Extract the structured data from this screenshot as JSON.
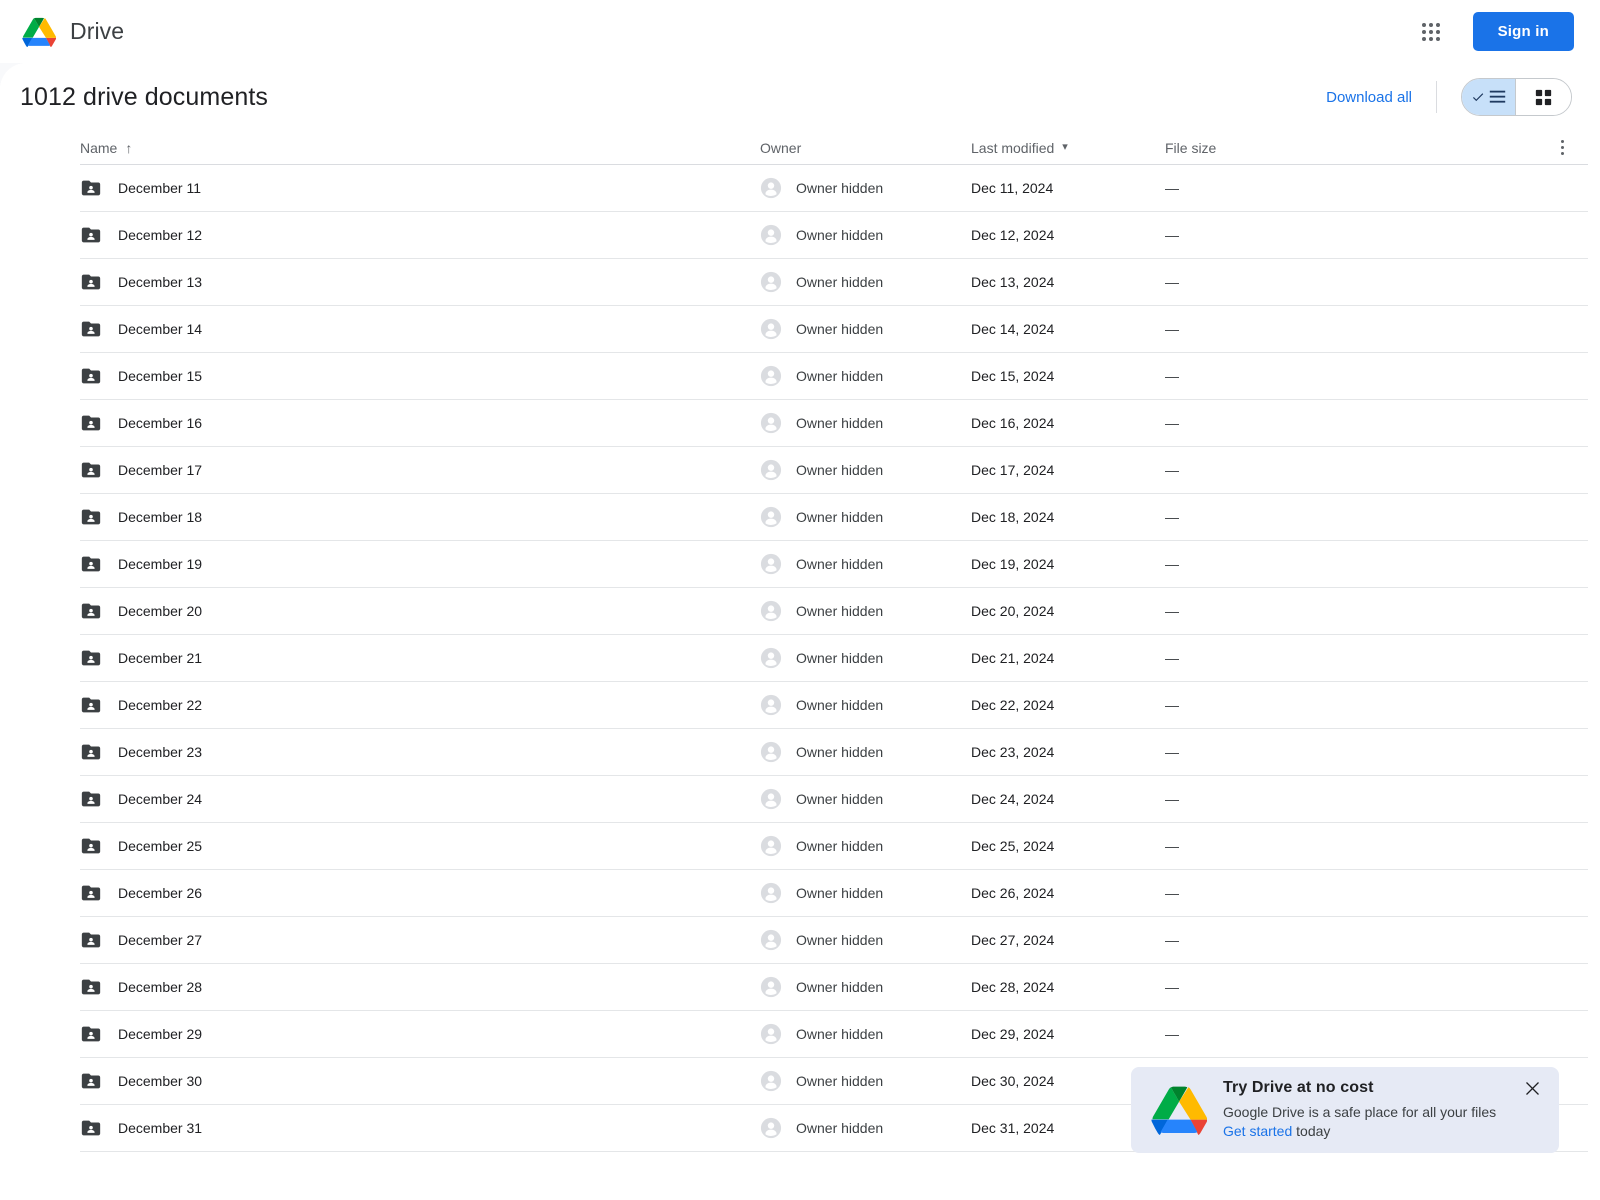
{
  "topbar": {
    "brand_name": "Drive",
    "apps_icon": "apps-grid-icon",
    "signin_label": "Sign in"
  },
  "subheader": {
    "title": "1012 drive documents",
    "download_all_label": "Download all",
    "list_view_icon": "list-view-icon",
    "grid_view_icon": "grid-view-icon",
    "active_view": "list"
  },
  "table": {
    "columns": {
      "name": "Name",
      "owner": "Owner",
      "last_modified": "Last modified",
      "file_size": "File size"
    },
    "sort_column": "Name",
    "sort_arrow": "↑",
    "modified_caret": "▾",
    "more_icon": "more-vertical-icon",
    "rows": [
      {
        "name": "December 11",
        "owner": "Owner hidden",
        "modified": "Dec 11, 2024",
        "size": "—"
      },
      {
        "name": "December 12",
        "owner": "Owner hidden",
        "modified": "Dec 12, 2024",
        "size": "—"
      },
      {
        "name": "December 13",
        "owner": "Owner hidden",
        "modified": "Dec 13, 2024",
        "size": "—"
      },
      {
        "name": "December 14",
        "owner": "Owner hidden",
        "modified": "Dec 14, 2024",
        "size": "—"
      },
      {
        "name": "December 15",
        "owner": "Owner hidden",
        "modified": "Dec 15, 2024",
        "size": "—"
      },
      {
        "name": "December 16",
        "owner": "Owner hidden",
        "modified": "Dec 16, 2024",
        "size": "—"
      },
      {
        "name": "December 17",
        "owner": "Owner hidden",
        "modified": "Dec 17, 2024",
        "size": "—"
      },
      {
        "name": "December 18",
        "owner": "Owner hidden",
        "modified": "Dec 18, 2024",
        "size": "—"
      },
      {
        "name": "December 19",
        "owner": "Owner hidden",
        "modified": "Dec 19, 2024",
        "size": "—"
      },
      {
        "name": "December 20",
        "owner": "Owner hidden",
        "modified": "Dec 20, 2024",
        "size": "—"
      },
      {
        "name": "December 21",
        "owner": "Owner hidden",
        "modified": "Dec 21, 2024",
        "size": "—"
      },
      {
        "name": "December 22",
        "owner": "Owner hidden",
        "modified": "Dec 22, 2024",
        "size": "—"
      },
      {
        "name": "December 23",
        "owner": "Owner hidden",
        "modified": "Dec 23, 2024",
        "size": "—"
      },
      {
        "name": "December 24",
        "owner": "Owner hidden",
        "modified": "Dec 24, 2024",
        "size": "—"
      },
      {
        "name": "December 25",
        "owner": "Owner hidden",
        "modified": "Dec 25, 2024",
        "size": "—"
      },
      {
        "name": "December 26",
        "owner": "Owner hidden",
        "modified": "Dec 26, 2024",
        "size": "—"
      },
      {
        "name": "December 27",
        "owner": "Owner hidden",
        "modified": "Dec 27, 2024",
        "size": "—"
      },
      {
        "name": "December 28",
        "owner": "Owner hidden",
        "modified": "Dec 28, 2024",
        "size": "—"
      },
      {
        "name": "December 29",
        "owner": "Owner hidden",
        "modified": "Dec 29, 2024",
        "size": "—"
      },
      {
        "name": "December 30",
        "owner": "Owner hidden",
        "modified": "Dec 30, 2024",
        "size": "—"
      },
      {
        "name": "December 31",
        "owner": "Owner hidden",
        "modified": "Dec 31, 2024",
        "size": "—"
      }
    ]
  },
  "toast": {
    "title": "Try Drive at no cost",
    "text": "Google Drive is a safe place for all your files",
    "link_label": "Get started",
    "link_suffix": " today",
    "close_icon": "close-icon"
  },
  "colors": {
    "accent_blue": "#1a73e8",
    "drive_green": "#00ac47",
    "drive_yellow": "#ffba00",
    "drive_blue": "#2684fc",
    "drive_red": "#ea4335",
    "folder_gray": "#3c4043",
    "toast_bg": "#e6eaf5"
  }
}
